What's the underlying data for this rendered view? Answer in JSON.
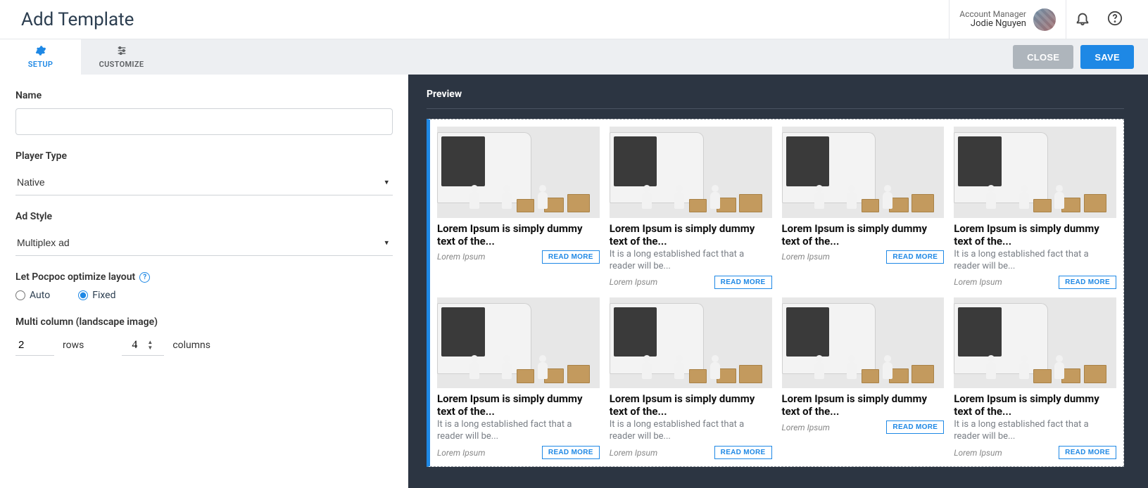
{
  "header": {
    "page_title": "Add Template",
    "account_role": "Account Manager",
    "account_name": "Jodie Nguyen"
  },
  "tabs": {
    "setup": "SETUP",
    "customize": "CUSTOMIZE"
  },
  "actions": {
    "close": "CLOSE",
    "save": "SAVE"
  },
  "form": {
    "name_label": "Name",
    "name_value": "",
    "player_type_label": "Player Type",
    "player_type_value": "Native",
    "ad_style_label": "Ad Style",
    "ad_style_value": "Multiplex ad",
    "layout_label": "Let Pocpoc optimize layout",
    "layout_options": {
      "auto": "Auto",
      "fixed": "Fixed"
    },
    "layout_selected": "fixed",
    "multi_col_label": "Multi column (landscape image)",
    "rows_value": "2",
    "rows_caption": "rows",
    "cols_value": "4",
    "cols_caption": "columns"
  },
  "preview": {
    "title": "Preview",
    "card": {
      "title": "Lorem Ipsum is simply dummy text of the...",
      "desc": "It is a long established fact that a reader will be...",
      "source": "Lorem Ipsum",
      "read_more": "READ MORE"
    },
    "cards_config": [
      {
        "show_desc": false
      },
      {
        "show_desc": true
      },
      {
        "show_desc": false
      },
      {
        "show_desc": true
      },
      {
        "show_desc": true
      },
      {
        "show_desc": true
      },
      {
        "show_desc": false
      },
      {
        "show_desc": true
      }
    ]
  }
}
